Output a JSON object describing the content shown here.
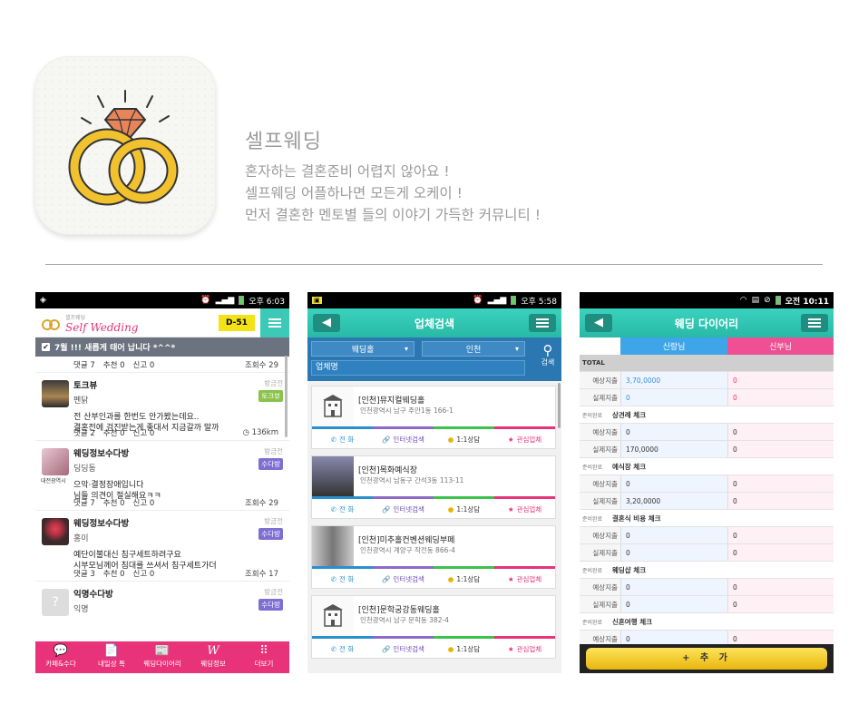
{
  "app": {
    "title": "셀프웨딩",
    "desc": [
      "혼자하는 결혼준비 어렵지 않아요 !",
      "셀프웨딩 어플하나면 모든게 오케이 !",
      "먼저 결혼한 멘토별 들의 이야기 가득한 커뮤니티 !"
    ]
  },
  "colors": {
    "brand_pink": "#e8337a",
    "teal": "#3cc9b7",
    "blue": "#2a77b1",
    "yellow": "#f4e219"
  },
  "phone1": {
    "status_time": "오후 6:03",
    "logo_small": "셀프웨딩",
    "logo": "Self Wedding",
    "dday": "D-51",
    "notice": "7월 !!! 새롭게 태어 납니다 *^^*",
    "notice_meta": {
      "comments": "댓글 7",
      "recommend": "추천 0",
      "report": "신고 0",
      "views": "조회수 29"
    },
    "posts": [
      {
        "title": "토크뷰",
        "author": "펜닭",
        "time": "방금전",
        "badge": "토크뷰",
        "badge_color": "#8bc34a",
        "body": [
          "전 산부인과를 한번도 안가봤는데요..",
          "결혼전에 검진받는게 좋대서 지금갈까 말까"
        ],
        "comments": "댓글 2",
        "recommend": "추천 0",
        "report": "신고 0",
        "right": "136km"
      },
      {
        "title": "웨딩정보수다방",
        "author": "딩딩동",
        "time": "방금전",
        "badge": "수다방",
        "badge_color": "#7e6fd3",
        "thumb_label": "대전광역시",
        "body": [
          "으악·결정장애입니다",
          "님들 의견이 절실해요ㅋㅋ"
        ],
        "comments": "댓글 7",
        "recommend": "추천 0",
        "report": "신고 0",
        "right": "조회수 29"
      },
      {
        "title": "웨딩정보수다방",
        "author": "홍이",
        "time": "방금전",
        "badge": "수다방",
        "badge_color": "#7e6fd3",
        "body": [
          "예단이불대신 침구세트하려구요",
          "시부모님께어 침대를 쓰셔서  침구세트가더"
        ],
        "comments": "댓글 3",
        "recommend": "추천 0",
        "report": "신고 0",
        "right": "조회수 17"
      },
      {
        "title": "익명수다방",
        "author": "익명",
        "time": "방금전",
        "badge": "수다방",
        "badge_color": "#7e6fd3"
      }
    ],
    "tabs": [
      {
        "icon": "💬",
        "label": "카페&수다"
      },
      {
        "icon": "📄",
        "label": "내일상 톡"
      },
      {
        "icon": "📰",
        "label": "웨딩다이어리"
      },
      {
        "icon": "W",
        "label": "웨딩정보"
      },
      {
        "icon": "⠿",
        "label": "더보기"
      }
    ]
  },
  "phone2": {
    "status_time": "오후 5:58",
    "title": "업체검색",
    "select1": "웨딩홀",
    "select2": "인천",
    "input_placeholder": "업체명",
    "search_label": "검색",
    "actions": [
      "전 화",
      "인터넷검색",
      "1:1상담",
      "관심업체"
    ],
    "cards": [
      {
        "name": "[인천]뮤지컬웨딩홀",
        "addr": "인천광역시 남구 주안1동 166-1"
      },
      {
        "name": "[인천]목화예식장",
        "addr": "인천광역시 남동구 간석3동 113-11"
      },
      {
        "name": "[인천]미추홀컨벤션웨딩부페",
        "addr": "인천광역시 계양구 작전동 866-4"
      },
      {
        "name": "[인천]문학궁강동웨딩홀",
        "addr": "인천광역시 남구 문학동 382-4"
      }
    ]
  },
  "phone3": {
    "status_time": "오전 10:11",
    "title": "웨딩 다이어리",
    "groom": "신랑님",
    "bride": "신부님",
    "total": "TOTAL",
    "total_rows": [
      {
        "label": "예상지출",
        "a": "3,70,0000",
        "b": "0"
      },
      {
        "label": "실제지출",
        "a": "0",
        "b": "0"
      }
    ],
    "sections": [
      {
        "tag": "준비완료",
        "name": "상견례 체크",
        "rows": [
          {
            "label": "예상지출",
            "a": "0",
            "b": "0"
          },
          {
            "label": "실제지출",
            "a": "170,0000",
            "b": "0"
          }
        ]
      },
      {
        "tag": "준비완료",
        "name": "예식장 체크",
        "rows": [
          {
            "label": "예상지출",
            "a": "0",
            "b": "0"
          },
          {
            "label": "실제지출",
            "a": "3,20,0000",
            "b": "0"
          }
        ]
      },
      {
        "tag": "준비완료",
        "name": "결혼식 비용 체크",
        "rows": [
          {
            "label": "예상지출",
            "a": "0",
            "b": "0"
          },
          {
            "label": "실제지출",
            "a": "0",
            "b": "0"
          }
        ]
      },
      {
        "tag": "준비완료",
        "name": "웨딩샵 체크",
        "rows": [
          {
            "label": "예상지출",
            "a": "0",
            "b": "0"
          },
          {
            "label": "실제지출",
            "a": "0",
            "b": "0"
          }
        ]
      },
      {
        "tag": "준비완료",
        "name": "신혼여행 체크",
        "rows": [
          {
            "label": "예상지출",
            "a": "0",
            "b": "0"
          }
        ]
      }
    ],
    "add_button": "+ 추 가"
  }
}
